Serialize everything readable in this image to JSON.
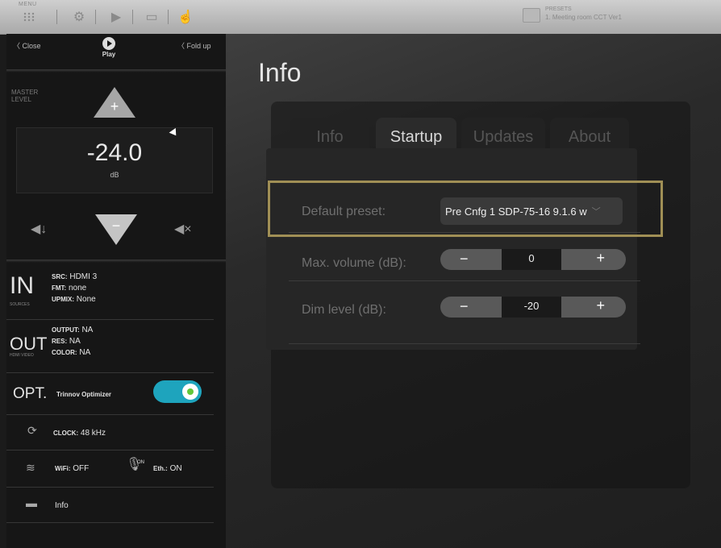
{
  "topbar": {
    "menu_label": "MENU",
    "presets_label": "PRESETS",
    "presets_value": "1. Meeting room CCT Ver1"
  },
  "left": {
    "close_label": "Close",
    "foldup_label": "Fold up",
    "play_logo_text": "Play",
    "master_label": "MASTER LEVEL",
    "level_value": "-24.0",
    "level_unit": "dB",
    "sources": {
      "big": "IN",
      "sub": "SOURCES",
      "src_key": "SRC:",
      "src_val": "HDMI 3",
      "fmt_key": "FMT:",
      "fmt_val": "none",
      "upmix_key": "UPMIX:",
      "upmix_val": "None"
    },
    "hdmi_out": {
      "big": "OUT",
      "sub": "HDMI VIDEO",
      "output_key": "OUTPUT:",
      "output_val": "NA",
      "res_key": "RES:",
      "res_val": "NA",
      "color_key": "COLOR:",
      "color_val": "NA"
    },
    "optimizer": {
      "big": "OPT.",
      "label": "Trinnov Optimizer",
      "enabled": true
    },
    "clock": {
      "key": "CLOCK:",
      "val": "48 kHz"
    },
    "network": {
      "wifi_key": "WiFi:",
      "wifi_val": "OFF",
      "on_label": "ON",
      "eth_key": "Eth.:",
      "eth_val": "ON"
    },
    "info_label": "Info"
  },
  "main": {
    "title": "Info",
    "tabs": [
      {
        "label": "Info",
        "active": false
      },
      {
        "label": "Startup",
        "active": true
      },
      {
        "label": "Updates",
        "active": false
      },
      {
        "label": "About",
        "active": false
      }
    ],
    "settings": {
      "default_preset_label": "Default preset:",
      "default_preset_value": "Pre Cnfg 1 SDP-75-16 9.1.6 w",
      "max_volume_label": "Max. volume (dB):",
      "max_volume_value": "0",
      "dim_level_label": "Dim level (dB):",
      "dim_level_value": "-20",
      "minus": "−",
      "plus": "+"
    }
  },
  "colors": {
    "accent_toggle": "#1ea4bd",
    "highlight_border": "#a08f55"
  },
  "icons": [
    "grid-icon",
    "gear-icon",
    "play-icon",
    "screen-icon",
    "hand-icon",
    "folder-icon",
    "volume-dim-icon",
    "mute-icon",
    "clock-icon",
    "wifi-icon",
    "microphone-icon",
    "info-device-icon"
  ]
}
